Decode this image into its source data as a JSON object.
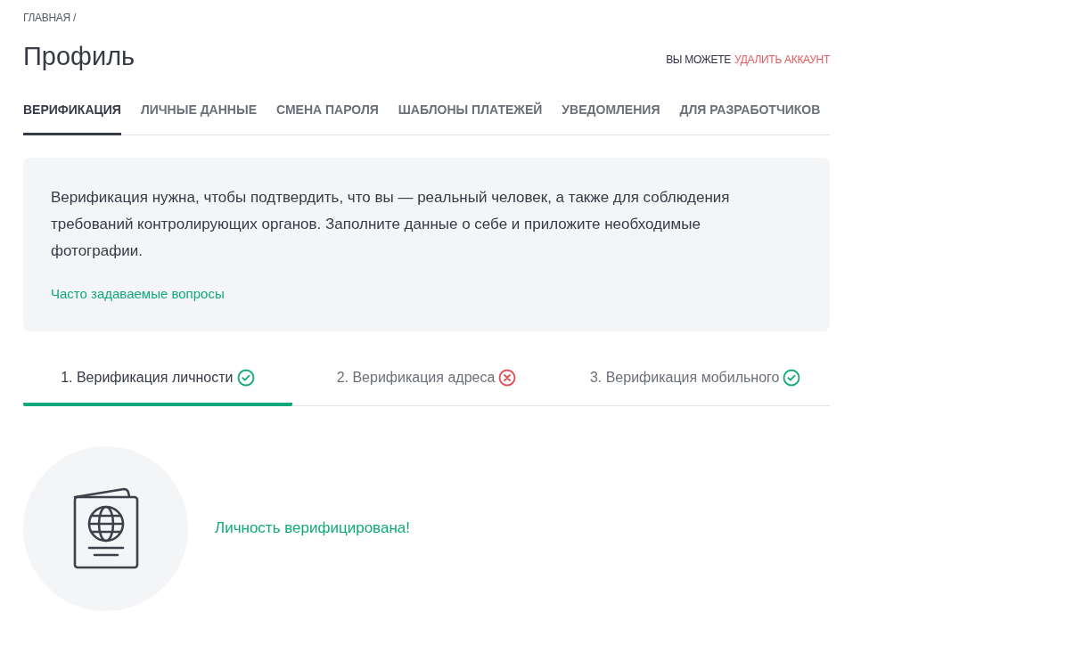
{
  "breadcrumb": "ГЛАВНАЯ /",
  "title": "Профиль",
  "account_note": {
    "prefix": "ВЫ МОЖЕТЕ",
    "link": "УДАЛИТЬ АККАУНТ"
  },
  "tabs": [
    {
      "label": "ВЕРИФИКАЦИЯ",
      "selected": true
    },
    {
      "label": "ЛИЧНЫЕ ДАННЫЕ",
      "selected": false
    },
    {
      "label": "СМЕНА ПАРОЛЯ",
      "selected": false
    },
    {
      "label": "ШАБЛОНЫ ПЛАТЕЖЕЙ",
      "selected": false
    },
    {
      "label": "УВЕДОМЛЕНИЯ",
      "selected": false
    },
    {
      "label": "ДЛЯ РАЗРАБОТЧИКОВ",
      "selected": false
    }
  ],
  "info": {
    "text": "Верификация нужна, чтобы подтвердить, что вы — реальный человек, а также для соблюдения требований контролирующих органов. Заполните данные о себе и приложите необходимые фотографии.",
    "link": "Часто задаваемые вопросы"
  },
  "steps": [
    {
      "label": "1. Верификация личности",
      "verified": true,
      "selected": true
    },
    {
      "label": "2. Верификация адреса",
      "verified": false,
      "selected": false
    },
    {
      "label": "3. Верификация мобильного",
      "verified": true,
      "selected": false
    }
  ],
  "result": {
    "message": "Личность верифицирована!"
  }
}
